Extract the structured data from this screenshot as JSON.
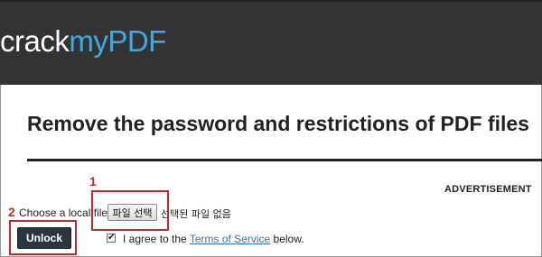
{
  "header": {
    "logo_part1": "crack",
    "logo_part2": "myPDF",
    "logo_color": "#3fa9e6",
    "background": "#333333"
  },
  "main": {
    "title": "Remove the password and restrictions of PDF files",
    "advertisement_label": "ADVERTISEMENT"
  },
  "upload": {
    "label": "Choose a local file:",
    "file_button_label": "파일 선택",
    "no_file_text": "선택된 파일 없음"
  },
  "actions": {
    "unlock_label": "Unlock"
  },
  "agreement": {
    "checkbox_mark": "✔",
    "text_before": "I agree to the ",
    "link_text": "Terms of Service",
    "text_after": " below."
  },
  "annotations": {
    "marker_1": "1",
    "marker_2": "2",
    "highlight_color": "#c0282a"
  }
}
